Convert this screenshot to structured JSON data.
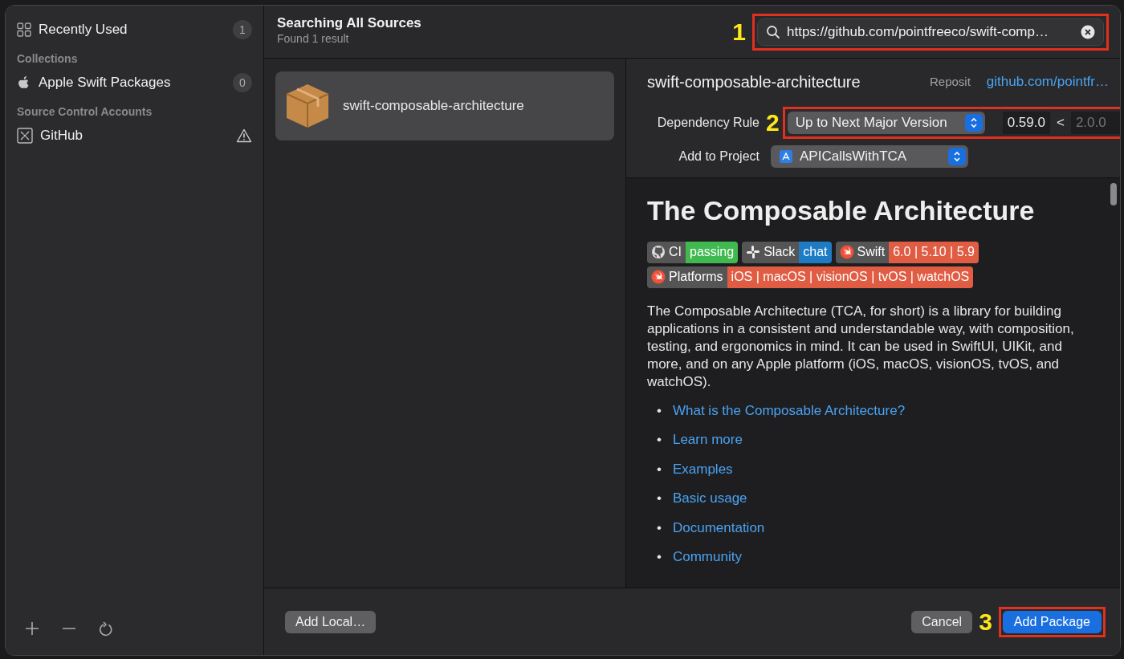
{
  "sidebar": {
    "items": [
      {
        "kind": "item",
        "label": "Recently Used",
        "count": "1",
        "warning": false
      },
      {
        "kind": "header",
        "label": "Collections"
      },
      {
        "kind": "item",
        "label": "Apple Swift Packages",
        "count": "0",
        "warning": false
      },
      {
        "kind": "header",
        "label": "Source Control Accounts"
      },
      {
        "kind": "item",
        "label": "GitHub",
        "warning": true
      }
    ]
  },
  "header": {
    "title": "Searching All Sources",
    "subtitle": "Found 1 result"
  },
  "search": {
    "value": "https://github.com/pointfreeco/swift-comp…"
  },
  "results": [
    {
      "name": "swift-composable-architecture",
      "selected": true
    }
  ],
  "details": {
    "name": "swift-composable-architecture",
    "repository_label": "Reposit",
    "repository_link": "github.com/pointfr…",
    "dependency_rule_label": "Dependency Rule",
    "rule": "Up to Next Major Version",
    "min_version": "0.59.0",
    "separator": "<",
    "max_version_placeholder": "2.0.0",
    "project_label": "Add to Project",
    "project": "APICallsWithTCA"
  },
  "readme": {
    "title": "The Composable Architecture",
    "badges": [
      {
        "label": "CI",
        "value": "passing",
        "color": "#3fb950"
      },
      {
        "label": "Slack",
        "value": "chat",
        "color": "#1e7cc4"
      },
      {
        "label": "Swift",
        "value": "6.0 | 5.10 | 5.9",
        "color": "#e05d44"
      },
      {
        "label": "Platforms",
        "value": "iOS | macOS | visionOS | tvOS | watchOS",
        "color": "#e05d44"
      }
    ],
    "paragraph": "The Composable Architecture (TCA, for short) is a library for building applications in a consistent and understandable way, with composition, testing, and ergonomics in mind. It can be used in SwiftUI, UIKit, and more, and on any Apple platform (iOS, macOS, visionOS, tvOS, and watchOS).",
    "links": [
      {
        "bullet": "•",
        "text": "What is the Composable Architecture?"
      },
      {
        "bullet": "•",
        "text": "Learn more"
      },
      {
        "bullet": "•",
        "text": "Examples"
      },
      {
        "bullet": "•",
        "text": "Basic usage"
      },
      {
        "bullet": "•",
        "text": "Documentation"
      },
      {
        "bullet": "•",
        "text": "Community"
      }
    ]
  },
  "buttons": {
    "add_local": "Add Local…",
    "cancel": "Cancel",
    "add_package": "Add Package"
  },
  "annotations": [
    {
      "label": "1"
    },
    {
      "label": "2"
    },
    {
      "label": "3"
    }
  ]
}
